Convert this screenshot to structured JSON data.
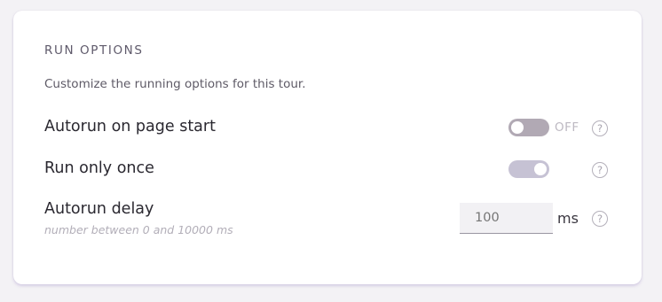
{
  "section": {
    "title": "RUN OPTIONS",
    "description": "Customize the running options for this tour."
  },
  "options": {
    "autorun": {
      "label": "Autorun on page start",
      "state_label": "OFF",
      "enabled": false,
      "help_glyph": "?"
    },
    "run_once": {
      "label": "Run only once",
      "enabled": true,
      "help_glyph": "?"
    },
    "delay": {
      "label": "Autorun delay",
      "hint": "number between 0 and 10000 ms",
      "placeholder": "100",
      "unit": "ms",
      "help_glyph": "?"
    }
  },
  "colors": {
    "toggle_off": "#b1a9b4",
    "toggle_on": "#c6c2d4",
    "card_shadow": "#a08cc8"
  },
  "icons": {
    "help": "help-circle-icon"
  }
}
